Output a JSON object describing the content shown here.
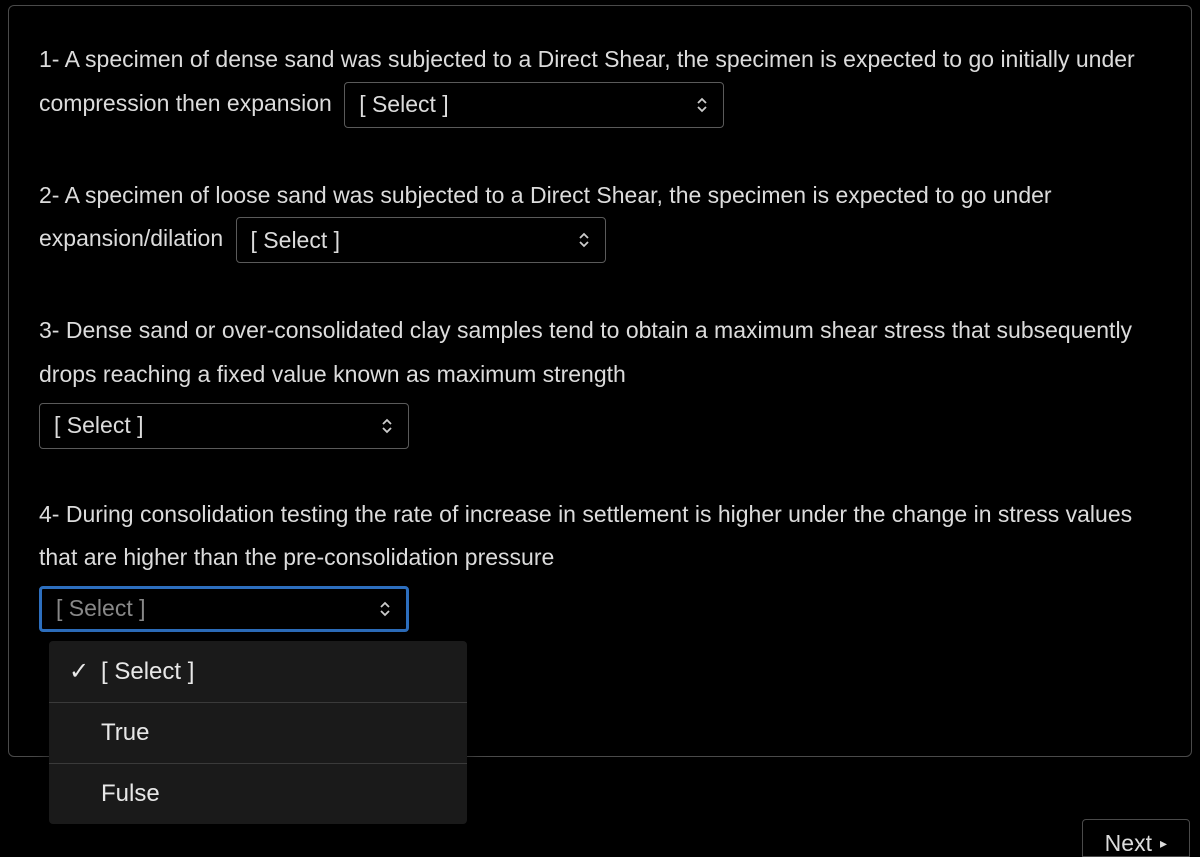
{
  "questions": {
    "q1_text": "1-  A specimen of dense sand was subjected to a Direct Shear, the specimen is expected to go initially under compression then expansion",
    "q1_select": "[ Select ]",
    "q2_text": "2- A specimen of loose sand was subjected to a Direct Shear, the specimen is expected to go under expansion/dilation",
    "q2_select": "[ Select ]",
    "q3_text": "3- Dense sand or over-consolidated clay samples tend to obtain a maximum shear stress that subsequently drops reaching a fixed value known as maximum strength",
    "q3_select": "[ Select ]",
    "q4_text": "4- During consolidation testing the rate of increase in settlement is higher under the change in stress values that are higher than the pre-consolidation pressure",
    "q4_select": "[ Select ]"
  },
  "dropdown": {
    "opt1": "[ Select ]",
    "opt2": "True",
    "opt3": "Fulse",
    "checkmark": "✓"
  },
  "nav": {
    "next": "Next"
  }
}
